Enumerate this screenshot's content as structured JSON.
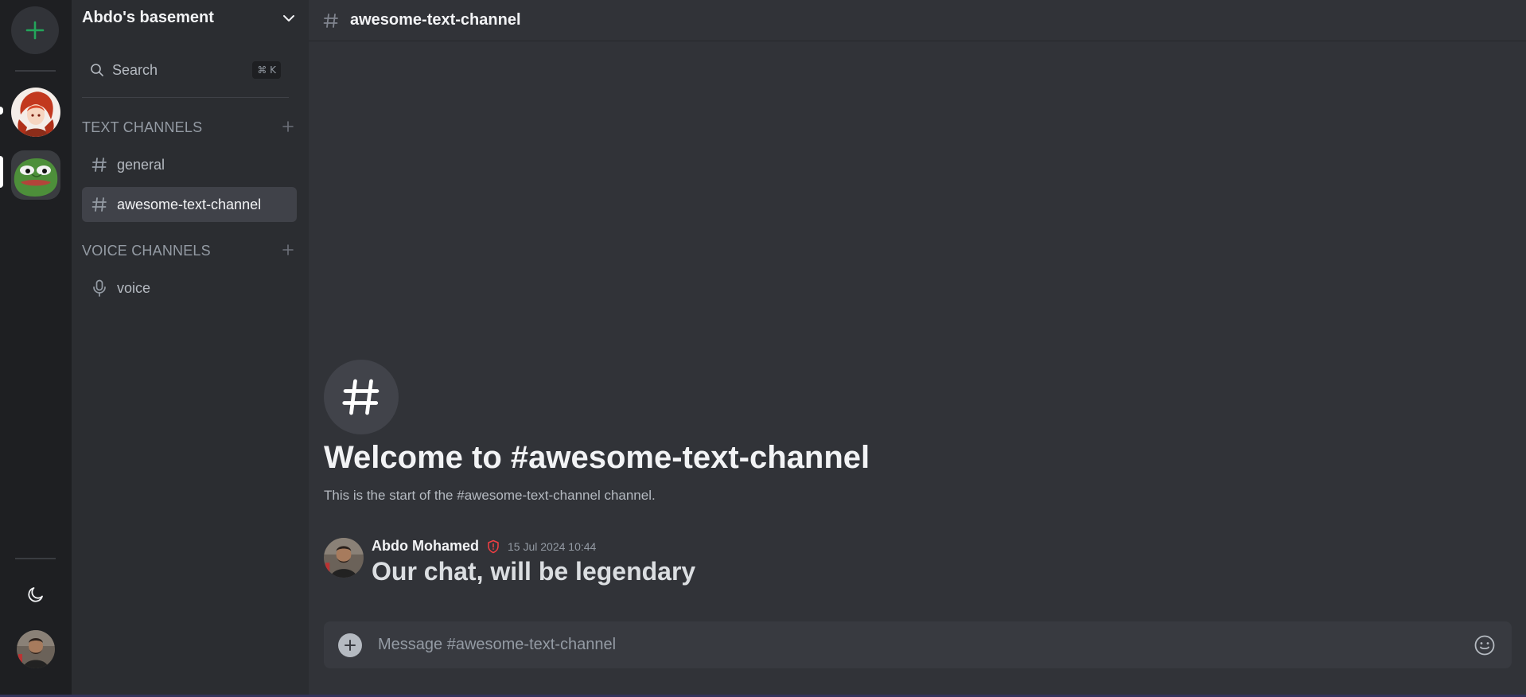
{
  "colors": {
    "rail_bg": "#1e1f22",
    "sidebar_bg": "#2b2d31",
    "main_bg": "#313338",
    "accent_green": "#23a55a",
    "badge_red": "#f23f43",
    "active_channel_bg": "#404249"
  },
  "rail": {
    "add_server_icon": "plus-icon",
    "servers": [
      {
        "name": "anime-server",
        "active": false
      },
      {
        "name": "pepe-server",
        "active": true
      }
    ],
    "theme_toggle_icon": "moon-icon",
    "user_avatar": "user-avatar"
  },
  "sidebar": {
    "server_name": "Abdo's basement",
    "search": {
      "label": "Search",
      "shortcut": "⌘ K"
    },
    "categories": [
      {
        "label": "TEXT CHANNELS",
        "channels": [
          {
            "label": "general",
            "type": "text",
            "active": false
          },
          {
            "label": "awesome-text-channel",
            "type": "text",
            "active": true
          }
        ]
      },
      {
        "label": "VOICE CHANNELS",
        "channels": [
          {
            "label": "voice",
            "type": "voice",
            "active": false
          }
        ]
      }
    ]
  },
  "main": {
    "header_title": "awesome-text-channel",
    "welcome_title": "Welcome to #awesome-text-channel",
    "welcome_sub": "This is the start of the #awesome-text-channel channel.",
    "messages": [
      {
        "author": "Abdo Mohamed",
        "badge_icon": "shield-alert-icon",
        "timestamp": "15 Jul 2024 10:44",
        "text": "Our chat, will be legendary"
      }
    ],
    "composer": {
      "placeholder": "Message #awesome-text-channel"
    }
  }
}
